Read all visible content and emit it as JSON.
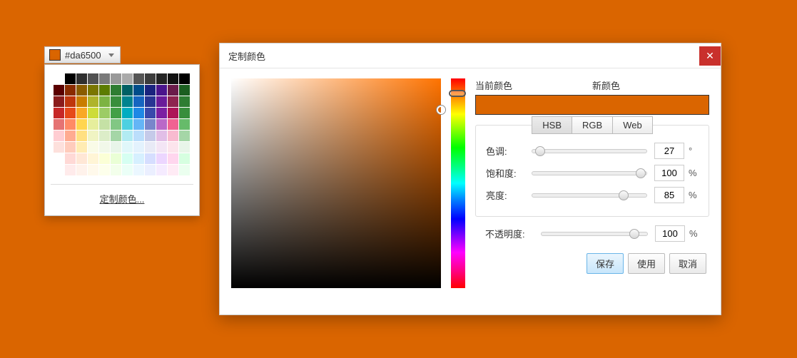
{
  "dropdown": {
    "hex": "#da6500",
    "swatch": "#da6500"
  },
  "palette": {
    "customLabel": "定制颜色...",
    "colors": [
      [
        "#ffffff",
        "#000000",
        "#2f2f2f",
        "#525252",
        "#7a7a7a",
        "#999999",
        "#aaaaaa",
        "#555555",
        "#3c3c3c",
        "#242424",
        "#121212",
        "#000000"
      ],
      [
        "#5a0000",
        "#8a2b00",
        "#8a5c00",
        "#7a7600",
        "#5c7c00",
        "#2e7d32",
        "#006064",
        "#004d8a",
        "#1a237e",
        "#4a148c",
        "#6a1b4a",
        "#1b5e20"
      ],
      [
        "#8a1c1c",
        "#bf360c",
        "#c97c00",
        "#afb42b",
        "#7cb342",
        "#388e3c",
        "#00838f",
        "#1565c0",
        "#283593",
        "#6a1b9a",
        "#8e244f",
        "#2e7d32"
      ],
      [
        "#c62828",
        "#e64a19",
        "#f9a825",
        "#cddc39",
        "#9ccc65",
        "#43a047",
        "#00acc1",
        "#1e88e5",
        "#3949ab",
        "#7b1fa2",
        "#ad1457",
        "#388e3c"
      ],
      [
        "#e57373",
        "#ff8a65",
        "#ffd54f",
        "#e6ee9c",
        "#c5e1a5",
        "#81c784",
        "#4dd0e1",
        "#64b5f6",
        "#7986cb",
        "#ba68c8",
        "#f06292",
        "#66bb6a"
      ],
      [
        "#ffcdd2",
        "#ffab91",
        "#ffe082",
        "#f0f4c3",
        "#dcedc8",
        "#a5d6a7",
        "#b2ebf2",
        "#bbdefb",
        "#c5cae9",
        "#e1bee7",
        "#f8bbd0",
        "#a5d6a7"
      ],
      [
        "#fde0dc",
        "#ffccbc",
        "#ffecb3",
        "#f9fbe7",
        "#f1f8e9",
        "#e8f5e9",
        "#e0f7fa",
        "#e3f2fd",
        "#e8eaf6",
        "#f3e5f5",
        "#fce4ec",
        "#e8f5e9"
      ],
      [
        "#ffffff",
        "#ffd9d6",
        "#ffe7d6",
        "#fff5d6",
        "#fbffd6",
        "#eaffd6",
        "#d6fff2",
        "#d6f0ff",
        "#d6deff",
        "#ecd6ff",
        "#ffd6ee",
        "#d6ffe0"
      ],
      [
        "#ffffff",
        "#ffebeb",
        "#fff2eb",
        "#fff9eb",
        "#fdffeb",
        "#f3ffeb",
        "#ebfff7",
        "#ebf7ff",
        "#ebefff",
        "#f5ebff",
        "#ffebf5",
        "#ebffef"
      ]
    ]
  },
  "dialog": {
    "title": "定制颜色",
    "currentColorLabel": "当前颜色",
    "newColorLabel": "新颜色",
    "currentColor": "#da6500",
    "newColor": "#da6500",
    "tabs": {
      "hsb": "HSB",
      "rgb": "RGB",
      "web": "Web",
      "active": "hsb"
    },
    "hsb": {
      "hue": {
        "label": "色调:",
        "value": 27,
        "unit": "°",
        "pct": 7
      },
      "saturation": {
        "label": "饱和度:",
        "value": 100,
        "unit": "%",
        "pct": 95
      },
      "brightness": {
        "label": "亮度:",
        "value": 85,
        "unit": "%",
        "pct": 80
      }
    },
    "opacity": {
      "label": "不透明度:",
      "value": 100,
      "unit": "%",
      "pct": 88
    },
    "buttons": {
      "save": "保存",
      "apply": "使用",
      "cancel": "取消"
    }
  }
}
